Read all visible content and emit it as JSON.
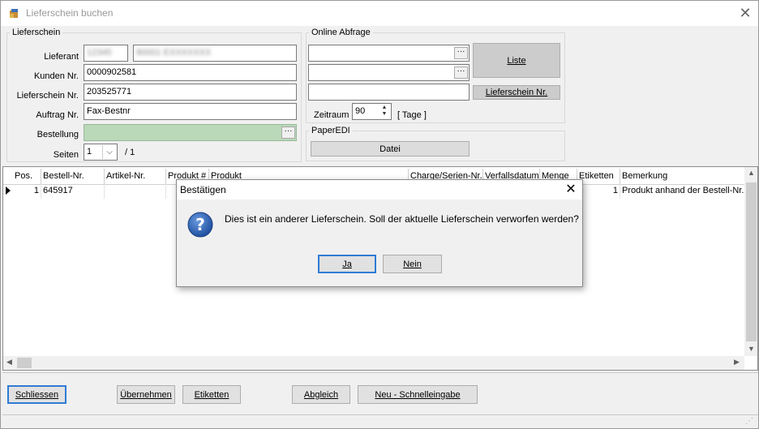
{
  "window": {
    "title": "Lieferschein buchen"
  },
  "lieferschein": {
    "group_label": "Lieferschein",
    "lieferant_label": "Lieferant",
    "lieferant_id": "12345",
    "lieferant_name": "80001 EXXXXXXX",
    "kunden_label": "Kunden Nr.",
    "kunden_value": "0000902581",
    "lieferschein_label": "Lieferschein Nr.",
    "lieferschein_value": "203525771",
    "auftrag_label": "Auftrag Nr.",
    "auftrag_value": "Fax-Bestnr",
    "bestellung_label": "Bestellung",
    "bestellung_value": "",
    "seiten_label": "Seiten",
    "seiten_value": "1",
    "seiten_total": "/ 1",
    "ellipsis": "···"
  },
  "online": {
    "group_label": "Online Abfrage",
    "liste_button": "Liste",
    "lieferschein_nr_button": "Lieferschein Nr.",
    "zeitraum_label": "Zeitraum",
    "zeitraum_value": "90",
    "tage_label": "[ Tage ]",
    "paperedi_label": "PaperEDI",
    "datei_button": "Datei"
  },
  "grid": {
    "columns": [
      "Pos.",
      "Bestell-Nr.",
      "Artikel-Nr.",
      "Produkt #",
      "Produkt",
      "Charge/Serien-Nr.",
      "Verfallsdatum",
      "Menge",
      "Etiketten",
      "Bemerkung"
    ],
    "rows": [
      {
        "pos": "1",
        "bestell_nr": "645917",
        "artikel_nr": "",
        "etiketten": "1",
        "bemerkung": "Produkt anhand der Bestell-Nr."
      }
    ]
  },
  "dialog": {
    "title": "Bestätigen",
    "message": "Dies ist ein anderer Lieferschein. Soll der aktuelle Lieferschein verworfen werden?",
    "yes_button": "Ja",
    "no_button": "Nein"
  },
  "bottom": {
    "schliessen": "Schliessen",
    "uebernehmen": "Übernehmen",
    "etiketten": "Etiketten",
    "abgleich": "Abgleich",
    "neu": "Neu - Schnelleingabe"
  },
  "colors": {
    "accent": "#2f7bd6",
    "bestellung_bg": "#b9d9b9",
    "question_icon": "#1f4fa0"
  }
}
